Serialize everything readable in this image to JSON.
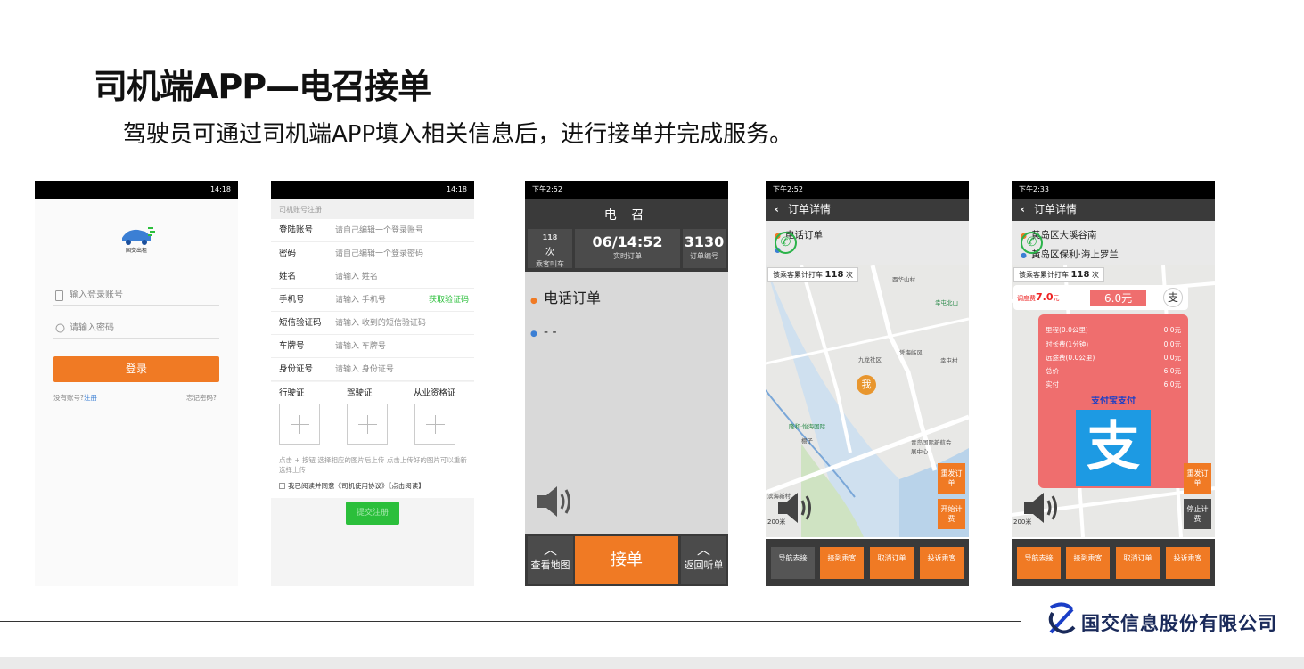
{
  "slide": {
    "title": "司机端APP—电召接单",
    "subtitle": "驾驶员可通过司机端APP填入相关信息后，进行接单并完成服务。",
    "company": "国交信息股份有限公司"
  },
  "screen_login": {
    "status_time": "14:18",
    "brand": "国交出租",
    "username_placeholder": "输入登录账号",
    "password_placeholder": "请输入密码",
    "login_button": "登录",
    "no_account": "没有账号?",
    "register_link": "注册",
    "forgot_password": "忘记密码?"
  },
  "screen_register": {
    "status_time": "14:18",
    "header": "司机账号注册",
    "fields": [
      {
        "label": "登陆账号",
        "placeholder": "请自己编辑一个登录账号"
      },
      {
        "label": "密码",
        "placeholder": "请自己编辑一个登录密码"
      },
      {
        "label": "姓名",
        "placeholder": "请输入 姓名"
      },
      {
        "label": "手机号",
        "placeholder": "请输入 手机号"
      },
      {
        "label": "短信验证码",
        "placeholder": "请输入 收到的短信验证码"
      },
      {
        "label": "车牌号",
        "placeholder": "请输入 车牌号"
      },
      {
        "label": "身份证号",
        "placeholder": "请输入 身份证号"
      }
    ],
    "get_code": "获取验证码",
    "upload_labels": [
      "行驶证",
      "驾驶证",
      "从业资格证"
    ],
    "upload_hint": "点击 + 按钮 选择相应的图片后上传 点击上传好的图片可以重新选择上传",
    "agreement": "我已阅读并同意《司机使用协议》【点击阅读】",
    "submit": "提交注册"
  },
  "screen_dispatch": {
    "status_time": "下午2:52",
    "title": "电 召",
    "stat1_value": "118",
    "stat1_unit": "次",
    "stat1_label": "乘客叫车",
    "stat2_value": "06/14:52",
    "stat2_label": "实时订单",
    "stat3_value": "3130",
    "stat3_label": "订单编号",
    "origin": "电话订单",
    "destination": "- -",
    "view_map": "查看地图",
    "accept": "接单",
    "back_listen": "返回听单"
  },
  "screen_order1": {
    "status_time": "下午2:52",
    "title": "订单详情",
    "origin": "电话订单",
    "count_prefix": "该乘客累计打车",
    "count_value": "118",
    "count_suffix": "次",
    "map_labels": [
      "西华山村",
      "幸屯北山",
      "九龙社区",
      "凭海临风",
      "幸屯村",
      "隆和·怡海国际",
      "棚子",
      "青岛国际新航会展中心",
      "滨海新村"
    ],
    "me": "我",
    "side_buttons": [
      "重发订单",
      "开始计费"
    ],
    "scale": "200米",
    "bottom_buttons": [
      "导航去接",
      "接到乘客",
      "取消订单",
      "投诉乘客"
    ]
  },
  "screen_order2": {
    "status_time": "下午2:33",
    "title": "订单详情",
    "origin": "黄岛区大溪谷南",
    "destination": "黄岛区保利·海上罗兰",
    "count_prefix": "该乘客累计打车",
    "count_value": "118",
    "count_suffix": "次",
    "dispatch_fee_label": "调度费",
    "dispatch_fee_value": "7.0",
    "dispatch_fee_unit": "元",
    "total_display": "6.0元",
    "pay_icon": "支",
    "fees": [
      {
        "label": "里程(0.0公里)",
        "value": "0.0元"
      },
      {
        "label": "时长费(1分钟)",
        "value": "0.0元"
      },
      {
        "label": "远途费(0.0公里)",
        "value": "0.0元"
      },
      {
        "label": "总价",
        "value": "6.0元"
      },
      {
        "label": "实付",
        "value": "6.0元"
      }
    ],
    "alipay_label": "支付宝支付",
    "alipay_glyph": "支",
    "side_buttons": [
      "重发订单",
      "停止计费"
    ],
    "scale": "200米",
    "bottom_buttons": [
      "导航去接",
      "接到乘客",
      "取消订单",
      "投诉乘客"
    ]
  },
  "colors": {
    "accent": "#f07a24",
    "green": "#2bbf3b",
    "dark": "#3a3a3a",
    "fee_red": "#ef6e6e",
    "alipay_blue": "#1d9ae3"
  }
}
